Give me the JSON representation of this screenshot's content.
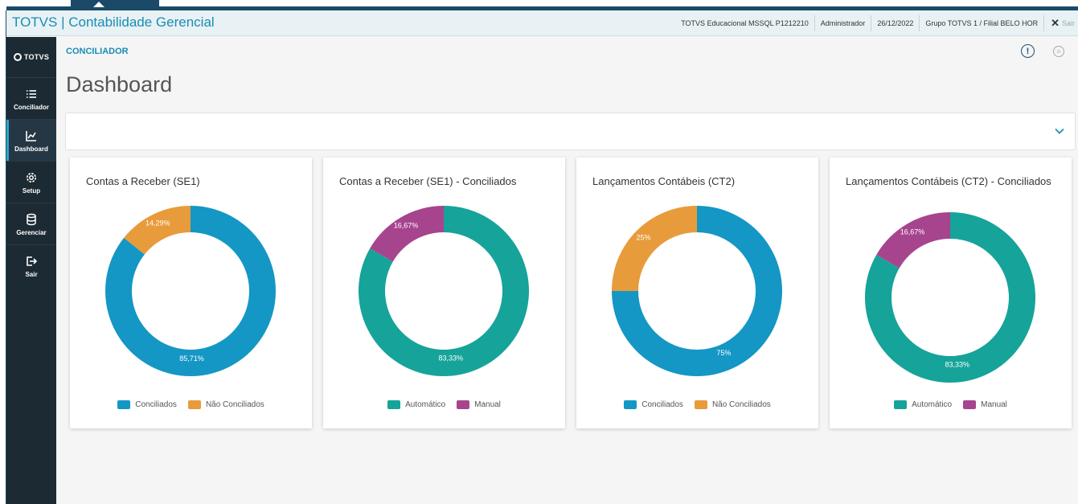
{
  "header": {
    "app_title": "TOTVS | Contabilidade Gerencial",
    "environment": "TOTVS Educacional MSSQL P1212210",
    "user": "Administrador",
    "date": "26/12/2022",
    "branch": "Grupo TOTVS 1 / Filial BELO HOR",
    "exit": "Sair"
  },
  "sidebar": {
    "logo": "TOTVS",
    "items": [
      {
        "label": "Conciliador",
        "icon": "list-icon"
      },
      {
        "label": "Dashboard",
        "icon": "chart-icon"
      },
      {
        "label": "Setup",
        "icon": "gear-icon"
      },
      {
        "label": "Gerenciar",
        "icon": "database-icon"
      },
      {
        "label": "Sair",
        "icon": "logout-icon"
      }
    ]
  },
  "breadcrumb": "CONCILIADOR",
  "page_title": "Dashboard",
  "colors": {
    "blue": "#1497c4",
    "orange": "#e89b3b",
    "teal": "#16a39a",
    "magenta": "#a7448e"
  },
  "chart_data": [
    {
      "type": "pie",
      "title": "Contas a Receber (SE1)",
      "categories": [
        "Conciliados",
        "Não Conciliados"
      ],
      "values": [
        85.71,
        14.29
      ],
      "labels": [
        "85,71%",
        "14,29%"
      ],
      "colors": [
        "#1497c4",
        "#e89b3b"
      ],
      "legend": "bottom"
    },
    {
      "type": "pie",
      "title": "Contas a Receber (SE1) - Conciliados",
      "categories": [
        "Automático",
        "Manual"
      ],
      "values": [
        83.33,
        16.67
      ],
      "labels": [
        "83,33%",
        "16,67%"
      ],
      "colors": [
        "#16a39a",
        "#a7448e"
      ],
      "legend": "bottom"
    },
    {
      "type": "pie",
      "title": "Lançamentos Contábeis (CT2)",
      "categories": [
        "Conciliados",
        "Não Conciliados"
      ],
      "values": [
        75,
        25
      ],
      "labels": [
        "75%",
        "25%"
      ],
      "colors": [
        "#1497c4",
        "#e89b3b"
      ],
      "legend": "bottom"
    },
    {
      "type": "pie",
      "title": "Lançamentos Contábeis (CT2) - Conciliados",
      "categories": [
        "Automático",
        "Manual"
      ],
      "values": [
        83.33,
        16.67
      ],
      "labels": [
        "83,33%",
        "16,67%"
      ],
      "colors": [
        "#16a39a",
        "#a7448e"
      ],
      "legend": "bottom"
    }
  ]
}
